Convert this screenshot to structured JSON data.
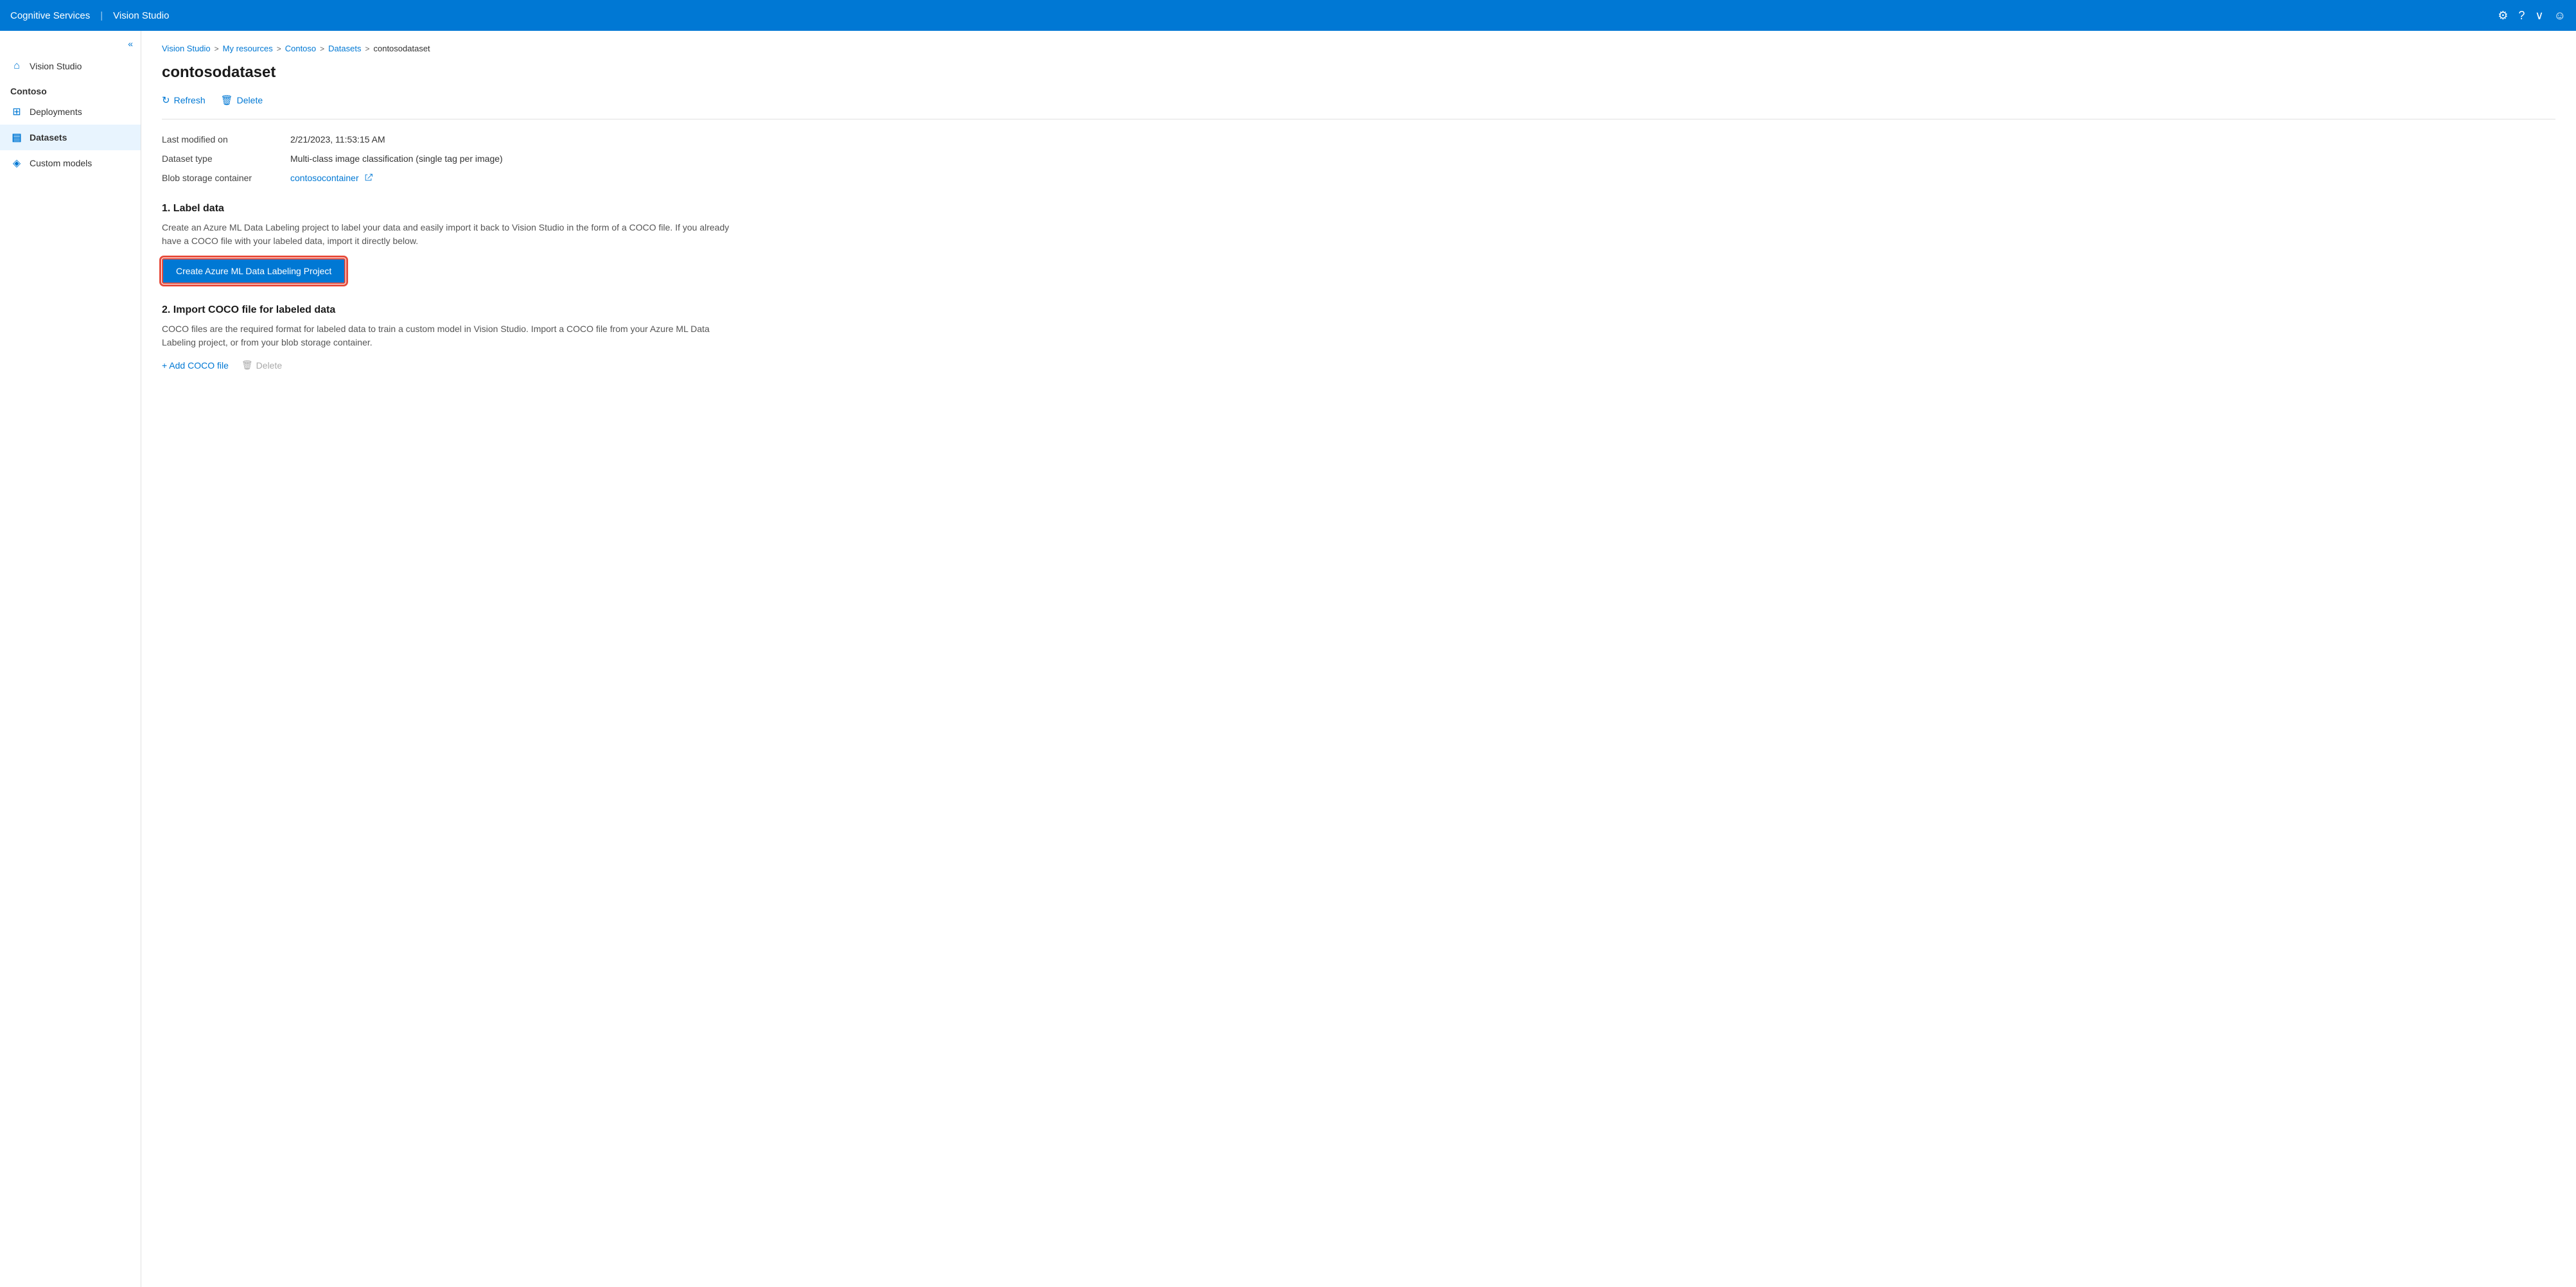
{
  "app": {
    "name": "Cognitive Services",
    "separator": "|",
    "product": "Vision Studio"
  },
  "topbar": {
    "settings_icon": "⚙",
    "help_icon": "?",
    "chevron_icon": "∨",
    "user_icon": "☺"
  },
  "sidebar": {
    "collapse_icon": "«",
    "items": [
      {
        "id": "vision-studio",
        "label": "Vision Studio",
        "icon": "⌂"
      },
      {
        "id": "contoso-section",
        "label": "Contoso",
        "type": "section"
      },
      {
        "id": "deployments",
        "label": "Deployments",
        "icon": "⊞"
      },
      {
        "id": "datasets",
        "label": "Datasets",
        "icon": "▤",
        "active": true
      },
      {
        "id": "custom-models",
        "label": "Custom models",
        "icon": "◈"
      }
    ]
  },
  "breadcrumb": {
    "items": [
      {
        "id": "vision-studio",
        "label": "Vision Studio",
        "link": true
      },
      {
        "id": "my-resources",
        "label": "My resources",
        "link": true
      },
      {
        "id": "contoso",
        "label": "Contoso",
        "link": true
      },
      {
        "id": "datasets",
        "label": "Datasets",
        "link": true
      },
      {
        "id": "contosodataset",
        "label": "contosodataset",
        "link": false
      }
    ],
    "separator": ">"
  },
  "page": {
    "title": "contosodataset"
  },
  "toolbar": {
    "refresh_label": "Refresh",
    "delete_label": "Delete",
    "refresh_icon": "↻",
    "delete_icon": "🗑"
  },
  "info": {
    "rows": [
      {
        "label": "Last modified on",
        "value": "2/21/2023, 11:53:15 AM",
        "type": "text"
      },
      {
        "label": "Dataset type",
        "value": "Multi-class image classification (single tag per image)",
        "type": "text"
      },
      {
        "label": "Blob storage container",
        "value": "contosocontainer",
        "type": "link"
      }
    ]
  },
  "sections": [
    {
      "id": "label-data",
      "number": "1",
      "title": "Label data",
      "description": "Create an Azure ML Data Labeling project to label your data and easily import it back to Vision Studio in the form of a COCO file. If you already have a COCO file with your labeled data, import it directly below.",
      "button_label": "Create Azure ML Data Labeling Project"
    },
    {
      "id": "import-coco",
      "number": "2",
      "title": "Import COCO file for labeled data",
      "description": "COCO files are the required format for labeled data to train a custom model in Vision Studio. Import a COCO file from your Azure ML Data Labeling project, or from your blob storage container.",
      "add_label": "+ Add COCO file",
      "delete_label": "Delete"
    }
  ]
}
